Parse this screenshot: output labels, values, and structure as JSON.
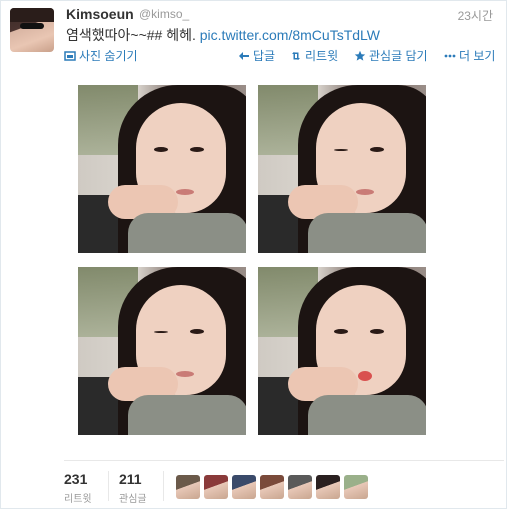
{
  "user": {
    "name": "Kimsoeun",
    "handle": "@kimso_",
    "time": "23시간"
  },
  "tweet": {
    "text": "염색했따아~~## 헤헤. ",
    "link": "pic.twitter.com/8mCuTsTdLW"
  },
  "actions": {
    "hide_photo": "사진 숨기기",
    "reply": "답글",
    "retweet": "리트윗",
    "favorite": "관심글 담기",
    "more": "더 보기"
  },
  "stats": {
    "retweets_count": "231",
    "retweets_label": "리트윗",
    "favorites_count": "211",
    "favorites_label": "관심글"
  },
  "colors": {
    "link": "#2b7bb9",
    "favorite_avatars": [
      "#6b5a4a",
      "#8a3a3a",
      "#3a4a6a",
      "#7a4a3a",
      "#5a5a5a",
      "#2a2020",
      "#9ab08a"
    ]
  },
  "icons": {
    "hide_photo": "photo-icon",
    "reply": "reply-icon",
    "retweet": "retweet-icon",
    "favorite": "star-icon",
    "more": "more-dots-icon"
  }
}
